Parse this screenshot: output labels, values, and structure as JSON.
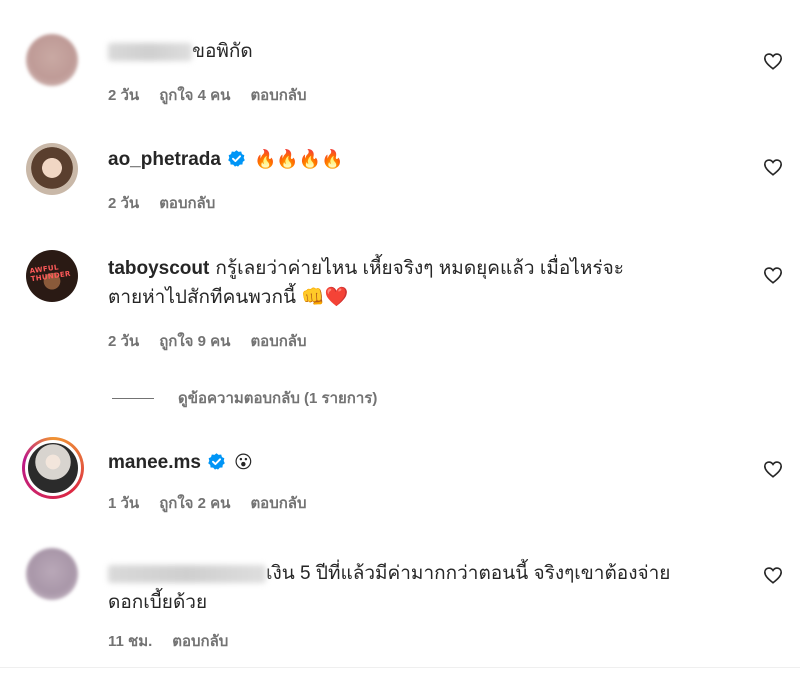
{
  "comments": [
    {
      "username": "",
      "text": "ขอพิกัด",
      "time": "2 วัน",
      "likes": "ถูกใจ 4 คน",
      "reply": "ตอบกลับ",
      "verified": false
    },
    {
      "username": "ao_phetrada",
      "text": "🔥🔥🔥🔥",
      "time": "2 วัน",
      "reply": "ตอบกลับ",
      "verified": true
    },
    {
      "username": "taboyscout",
      "text": "กรู้เลยว่าค่ายไหน เหี้ยจริงๆ หมดยุคแล้ว เมื่อไหร่จะ",
      "text2": "ตายห่าไปสักทีคนพวกนี้ 👊❤️",
      "time": "2 วัน",
      "likes": "ถูกใจ 9 คน",
      "reply": "ตอบกลับ",
      "verified": false,
      "avatar_text": "AWFUL THUNDER"
    },
    {
      "username": "manee.ms",
      "text": "😮",
      "time": "1 วัน",
      "likes": "ถูกใจ 2 คน",
      "reply": "ตอบกลับ",
      "verified": true
    },
    {
      "username": "",
      "text": "เงิน 5 ปีที่แล้วมีค่ามากกว่าตอนนี้ จริงๆเขาต้องจ่าย",
      "text2": "ดอกเบี้ยด้วย",
      "time": "11 ชม.",
      "reply": "ตอบกลับ",
      "verified": false
    }
  ],
  "view_replies": "ดูข้อความตอบกลับ (1 รายการ)",
  "icons": {
    "like": "heart-outline-icon",
    "verified": "verified-badge-icon"
  },
  "colors": {
    "verified": "#0095f6",
    "meta": "#737373",
    "text": "#262626"
  }
}
